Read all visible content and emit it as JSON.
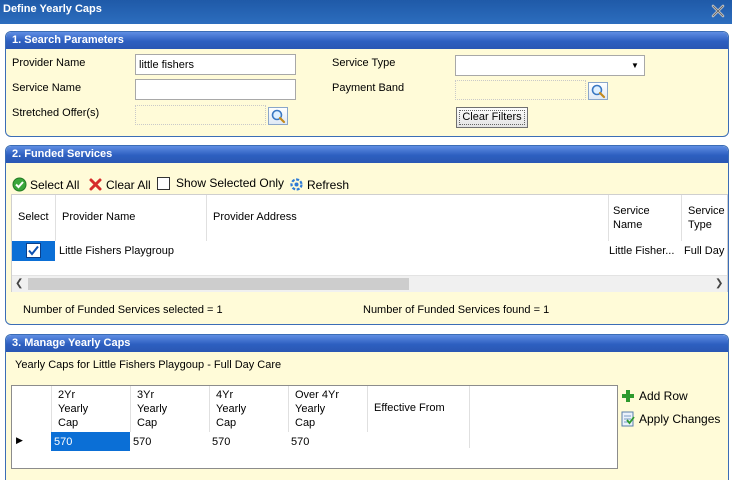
{
  "window": {
    "title": "Define Yearly Caps"
  },
  "search": {
    "header": "1. Search Parameters",
    "provider_name_label": "Provider Name",
    "provider_name_value": "little fishers",
    "service_type_label": "Service Type",
    "service_type_value": "",
    "service_name_label": "Service Name",
    "service_name_value": "",
    "payment_band_label": "Payment Band",
    "payment_band_value": "",
    "stretched_offer_label": "Stretched Offer(s)",
    "stretched_offer_value": "",
    "clear_filters_label": "Clear Filters"
  },
  "funded": {
    "header": "2. Funded Services",
    "toolbar": {
      "select_all": "Select All",
      "clear_all": "Clear All",
      "show_selected_only": "Show Selected Only",
      "refresh": "Refresh"
    },
    "columns": {
      "select": "Select",
      "provider_name": "Provider Name",
      "provider_address": "Provider Address",
      "service_name_1": "Service",
      "service_name_2": "Name",
      "service_type_1": "Service",
      "service_type_2": "Type"
    },
    "rows": [
      {
        "selected": true,
        "provider_name": "Little Fishers Playgroup",
        "provider_address": "",
        "service_name": "Little Fisher...",
        "service_type": "Full Day C"
      }
    ],
    "selected_count_text": "Number of Funded Services selected = 1",
    "found_count_text": "Number of Funded Services found = 1",
    "scroll_position": 0.0
  },
  "manage": {
    "header": "3. Manage Yearly Caps",
    "caption": "Yearly Caps for Little Fishers Playgoup - Full Day Care",
    "columns": [
      [
        "2Yr",
        "Yearly",
        "Cap"
      ],
      [
        "3Yr",
        "Yearly",
        "Cap"
      ],
      [
        "4Yr",
        "Yearly",
        "Cap"
      ],
      [
        "Over 4Yr",
        "Yearly",
        "Cap"
      ],
      [
        "Effective From",
        "",
        ""
      ]
    ],
    "row": {
      "two_yr": "570",
      "three_yr": "570",
      "four_yr": "570",
      "over_four_yr": "570",
      "effective_from": ""
    },
    "add_row_label": "Add Row",
    "apply_changes_label": "Apply Changes"
  },
  "colors": {
    "header_blue": "#2d5fc0",
    "panel_bg": "#fffbd8",
    "selection_blue": "#0b6fd6"
  }
}
